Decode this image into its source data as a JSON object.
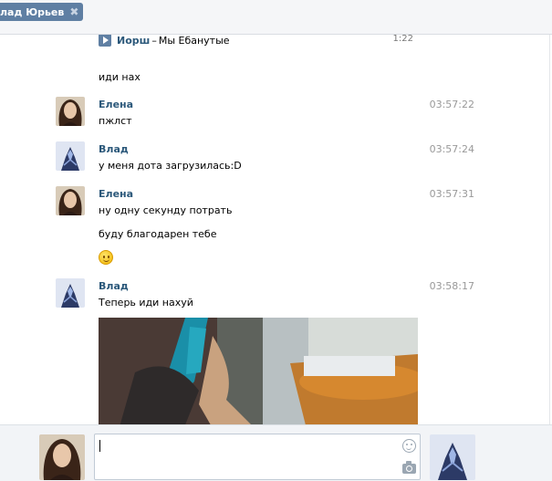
{
  "tab": {
    "label": "лад Юрьев",
    "close_glyph": "✖"
  },
  "audio": {
    "artist": "Иорш",
    "separator": "–",
    "title": "Мы Ебанутые",
    "duration": "1:22"
  },
  "messages": [
    {
      "sender": "",
      "time": "",
      "text": "иди нах"
    },
    {
      "sender": "Елена",
      "time": "03:57:22",
      "text": "пжлст"
    },
    {
      "sender": "Влад",
      "time": "03:57:24",
      "text": "у меня дота загрузилась:D"
    },
    {
      "sender": "Елена",
      "time": "03:57:31",
      "text": "ну одну секунду потрать",
      "text2": "буду благодарен тебе",
      "emoji": "smile-emoji"
    },
    {
      "sender": "Влад",
      "time": "03:58:17",
      "text": "Теперь иди нахуй",
      "attachment": "photo"
    }
  ],
  "composer": {
    "input_value": ""
  },
  "colors": {
    "link": "#2b587a",
    "tab_bg": "#5f7fa3",
    "time": "#999999"
  },
  "icons": [
    "play-icon",
    "close-icon",
    "smile-icon",
    "camera-icon"
  ]
}
